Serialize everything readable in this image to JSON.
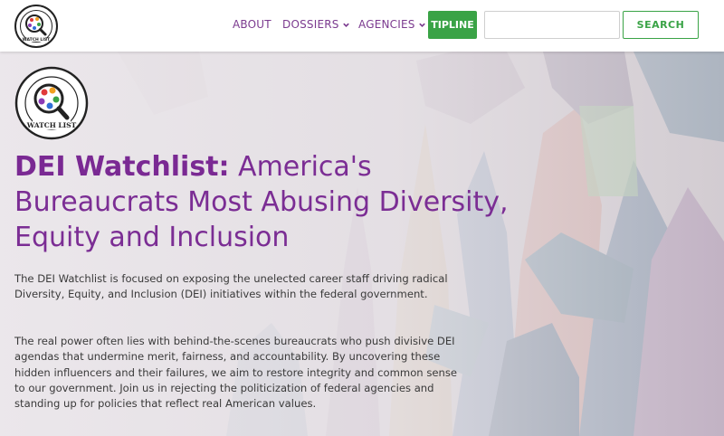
{
  "nav": {
    "logo_text": "DIVERSITY, EQUITY & INCLUSION WATCH LIST",
    "about": "ABOUT",
    "dossiers": "DOSSIERS",
    "agencies": "AGENCIES",
    "tipline": "TIPLINE",
    "search_placeholder": "",
    "search_button": "SEARCH"
  },
  "hero": {
    "logo_top_text": "DIVERSITY, EQUITY & INCLUSION",
    "logo_bottom_text": "WATCH LIST",
    "headline_bold": "DEI Watchlist:",
    "headline_rest": " America's Bureaucrats Most Abusing Diversity, Equity and Inclusion",
    "paragraph1": "The DEI  Watchlist is focused on exposing the unelected career staff driving radical Diversity, Equity, and Inclusion (DEI) initiatives within the federal government.",
    "paragraph2": "The real power often lies with behind-the-scenes bureaucrats who push divisive DEI agendas that undermine merit, fairness, and accountability. By uncovering these hidden influencers and their failures, we aim to restore integrity and common sense to our government. Join us in rejecting the politicization of federal agencies and standing up for policies that reflect real American values."
  },
  "colors": {
    "brand_purple": "#7b2d94",
    "accent_green": "#3aa346",
    "body_text": "#3a3a3a"
  },
  "icons": {
    "logo": "magnifier-people-logo",
    "dropdown": "chevron-down-icon"
  }
}
